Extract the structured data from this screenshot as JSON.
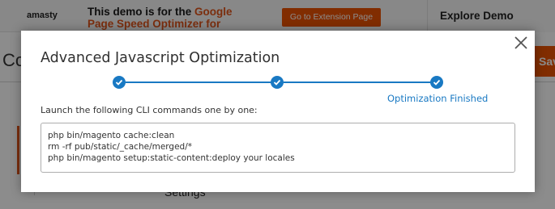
{
  "background": {
    "brand": "amasty",
    "demo_prefix": "This demo is for the ",
    "demo_highlight": "Google Page Speed Optimizer for",
    "extension_button": "Go to Extension Page",
    "explore": "Explore Demo",
    "heading_fragment": "Co",
    "save_fragment": "Sav",
    "settings": "Settings",
    "accent_color": "#eb5202"
  },
  "modal": {
    "title": "Advanced Javascript Optimization",
    "close_icon": "close-icon",
    "steps": [
      {
        "label": "",
        "status": "complete"
      },
      {
        "label": "",
        "status": "complete"
      },
      {
        "label": "Optimization Finished",
        "status": "complete"
      }
    ],
    "step_color": "#1979c3",
    "instruction": "Launch the following CLI commands one by one:",
    "commands": [
      "php bin/magento cache:clean",
      "rm -rf pub/static/_cache/merged/*",
      "php bin/magento setup:static-content:deploy your locales"
    ]
  }
}
